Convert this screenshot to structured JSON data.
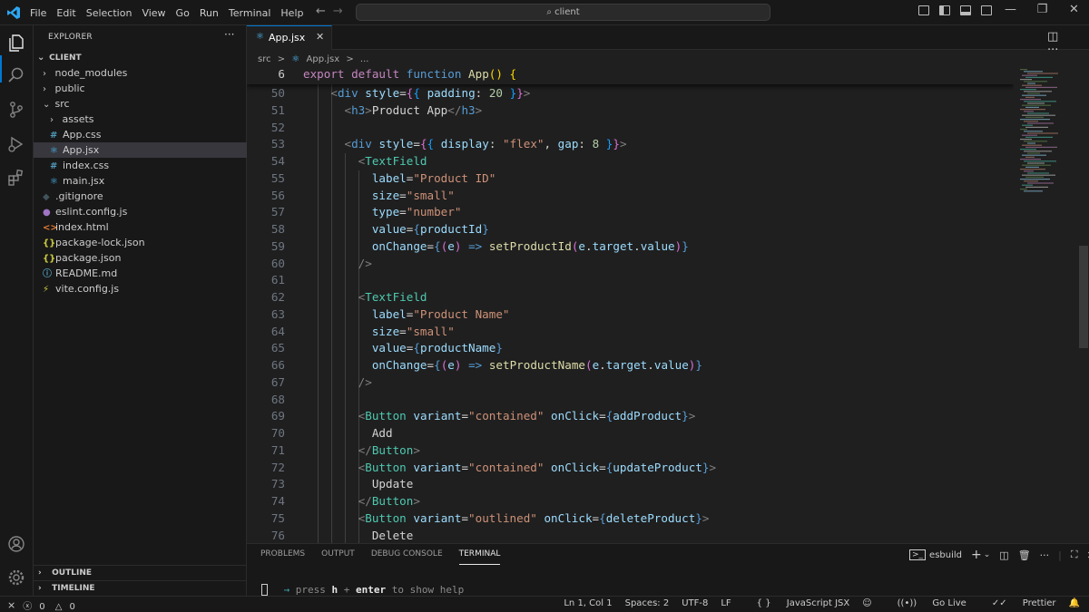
{
  "titlebar": {
    "menu": [
      "File",
      "Edit",
      "Selection",
      "View",
      "Go",
      "Run",
      "Terminal",
      "Help"
    ],
    "search": "client"
  },
  "sidebar": {
    "title": "EXPLORER",
    "more": "···",
    "root": "CLIENT",
    "items": [
      {
        "label": "node_modules",
        "type": "folder",
        "indent": 1,
        "icon": ""
      },
      {
        "label": "public",
        "type": "folder",
        "indent": 1,
        "icon": ""
      },
      {
        "label": "src",
        "type": "folder-open",
        "indent": 1,
        "icon": ""
      },
      {
        "label": "assets",
        "type": "folder",
        "indent": 2,
        "icon": ""
      },
      {
        "label": "App.css",
        "type": "file",
        "indent": 2,
        "icon": "#",
        "color": "#519aba"
      },
      {
        "label": "App.jsx",
        "type": "file",
        "indent": 2,
        "icon": "⚛",
        "color": "#4fc1ff",
        "selected": true
      },
      {
        "label": "index.css",
        "type": "file",
        "indent": 2,
        "icon": "#",
        "color": "#519aba"
      },
      {
        "label": "main.jsx",
        "type": "file",
        "indent": 2,
        "icon": "⚛",
        "color": "#4fc1ff"
      },
      {
        "label": ".gitignore",
        "type": "file",
        "indent": 1,
        "icon": "◆",
        "color": "#41535b"
      },
      {
        "label": "eslint.config.js",
        "type": "file",
        "indent": 1,
        "icon": "●",
        "color": "#a074c4"
      },
      {
        "label": "index.html",
        "type": "file",
        "indent": 1,
        "icon": "<>",
        "color": "#e37933"
      },
      {
        "label": "package-lock.json",
        "type": "file",
        "indent": 1,
        "icon": "{}",
        "color": "#cbcb41"
      },
      {
        "label": "package.json",
        "type": "file",
        "indent": 1,
        "icon": "{}",
        "color": "#cbcb41"
      },
      {
        "label": "README.md",
        "type": "file",
        "indent": 1,
        "icon": "ⓘ",
        "color": "#519aba"
      },
      {
        "label": "vite.config.js",
        "type": "file",
        "indent": 1,
        "icon": "⚡",
        "color": "#cbcb41"
      }
    ],
    "outline": "OUTLINE",
    "timeline": "TIMELINE"
  },
  "editor": {
    "tab_label": "App.jsx",
    "breadcrumb": [
      "src",
      ">",
      "App.jsx",
      ">",
      "..."
    ],
    "sticky": {
      "num": "6",
      "tokens": [
        [
          "kw",
          "export"
        ],
        [
          "txt",
          " "
        ],
        [
          "kw",
          "default"
        ],
        [
          "txt",
          " "
        ],
        [
          "kw2",
          "function"
        ],
        [
          "txt",
          " "
        ],
        [
          "fn",
          "App"
        ],
        [
          "brk",
          "()"
        ],
        [
          "txt",
          " "
        ],
        [
          "brk",
          "{"
        ]
      ]
    },
    "lines": [
      {
        "num": "50",
        "indent": 2,
        "tokens": [
          [
            "pun",
            "<"
          ],
          [
            "kw2",
            "div"
          ],
          [
            "txt",
            " "
          ],
          [
            "attr",
            "style"
          ],
          [
            "txt",
            "="
          ],
          [
            "brk2",
            "{"
          ],
          [
            "brk3",
            "{"
          ],
          [
            "txt",
            " "
          ],
          [
            "attr",
            "padding"
          ],
          [
            "txt",
            ": "
          ],
          [
            "num",
            "20"
          ],
          [
            "txt",
            " "
          ],
          [
            "brk3",
            "}"
          ],
          [
            "brk2",
            "}"
          ],
          [
            "pun",
            ">"
          ]
        ]
      },
      {
        "num": "51",
        "indent": 3,
        "tokens": [
          [
            "pun",
            "<"
          ],
          [
            "kw2",
            "h3"
          ],
          [
            "pun",
            ">"
          ],
          [
            "txt",
            "Product App"
          ],
          [
            "pun",
            "</"
          ],
          [
            "kw2",
            "h3"
          ],
          [
            "pun",
            ">"
          ]
        ]
      },
      {
        "num": "52",
        "indent": 0,
        "tokens": []
      },
      {
        "num": "53",
        "indent": 3,
        "tokens": [
          [
            "pun",
            "<"
          ],
          [
            "kw2",
            "div"
          ],
          [
            "txt",
            " "
          ],
          [
            "attr",
            "style"
          ],
          [
            "txt",
            "="
          ],
          [
            "brk2",
            "{"
          ],
          [
            "brk3",
            "{"
          ],
          [
            "txt",
            " "
          ],
          [
            "attr",
            "display"
          ],
          [
            "txt",
            ": "
          ],
          [
            "str",
            "\"flex\""
          ],
          [
            "txt",
            ", "
          ],
          [
            "attr",
            "gap"
          ],
          [
            "txt",
            ": "
          ],
          [
            "num",
            "8"
          ],
          [
            "txt",
            " "
          ],
          [
            "brk3",
            "}"
          ],
          [
            "brk2",
            "}"
          ],
          [
            "pun",
            ">"
          ]
        ]
      },
      {
        "num": "54",
        "indent": 4,
        "tokens": [
          [
            "pun",
            "<"
          ],
          [
            "tag",
            "TextField"
          ]
        ]
      },
      {
        "num": "55",
        "indent": 5,
        "tokens": [
          [
            "attr",
            "label"
          ],
          [
            "txt",
            "="
          ],
          [
            "str",
            "\"Product ID\""
          ]
        ]
      },
      {
        "num": "56",
        "indent": 5,
        "tokens": [
          [
            "attr",
            "size"
          ],
          [
            "txt",
            "="
          ],
          [
            "str",
            "\"small\""
          ]
        ]
      },
      {
        "num": "57",
        "indent": 5,
        "tokens": [
          [
            "attr",
            "type"
          ],
          [
            "txt",
            "="
          ],
          [
            "str",
            "\"number\""
          ]
        ]
      },
      {
        "num": "58",
        "indent": 5,
        "tokens": [
          [
            "attr",
            "value"
          ],
          [
            "txt",
            "="
          ],
          [
            "kw2",
            "{"
          ],
          [
            "attr",
            "productId"
          ],
          [
            "kw2",
            "}"
          ]
        ]
      },
      {
        "num": "59",
        "indent": 5,
        "tokens": [
          [
            "attr",
            "onChange"
          ],
          [
            "txt",
            "="
          ],
          [
            "kw2",
            "{"
          ],
          [
            "brk2",
            "("
          ],
          [
            "attr",
            "e"
          ],
          [
            "brk2",
            ")"
          ],
          [
            "txt",
            " "
          ],
          [
            "kw2",
            "=>"
          ],
          [
            "txt",
            " "
          ],
          [
            "fn",
            "setProductId"
          ],
          [
            "brk2",
            "("
          ],
          [
            "attr",
            "e"
          ],
          [
            "txt",
            "."
          ],
          [
            "attr",
            "target"
          ],
          [
            "txt",
            "."
          ],
          [
            "attr",
            "value"
          ],
          [
            "brk2",
            ")"
          ],
          [
            "kw2",
            "}"
          ]
        ]
      },
      {
        "num": "60",
        "indent": 4,
        "tokens": [
          [
            "pun",
            "/>"
          ]
        ]
      },
      {
        "num": "61",
        "indent": 0,
        "tokens": []
      },
      {
        "num": "62",
        "indent": 4,
        "tokens": [
          [
            "pun",
            "<"
          ],
          [
            "tag",
            "TextField"
          ]
        ]
      },
      {
        "num": "63",
        "indent": 5,
        "tokens": [
          [
            "attr",
            "label"
          ],
          [
            "txt",
            "="
          ],
          [
            "str",
            "\"Product Name\""
          ]
        ]
      },
      {
        "num": "64",
        "indent": 5,
        "tokens": [
          [
            "attr",
            "size"
          ],
          [
            "txt",
            "="
          ],
          [
            "str",
            "\"small\""
          ]
        ]
      },
      {
        "num": "65",
        "indent": 5,
        "tokens": [
          [
            "attr",
            "value"
          ],
          [
            "txt",
            "="
          ],
          [
            "kw2",
            "{"
          ],
          [
            "attr",
            "productName"
          ],
          [
            "kw2",
            "}"
          ]
        ]
      },
      {
        "num": "66",
        "indent": 5,
        "tokens": [
          [
            "attr",
            "onChange"
          ],
          [
            "txt",
            "="
          ],
          [
            "kw2",
            "{"
          ],
          [
            "brk2",
            "("
          ],
          [
            "attr",
            "e"
          ],
          [
            "brk2",
            ")"
          ],
          [
            "txt",
            " "
          ],
          [
            "kw2",
            "=>"
          ],
          [
            "txt",
            " "
          ],
          [
            "fn",
            "setProductName"
          ],
          [
            "brk2",
            "("
          ],
          [
            "attr",
            "e"
          ],
          [
            "txt",
            "."
          ],
          [
            "attr",
            "target"
          ],
          [
            "txt",
            "."
          ],
          [
            "attr",
            "value"
          ],
          [
            "brk2",
            ")"
          ],
          [
            "kw2",
            "}"
          ]
        ]
      },
      {
        "num": "67",
        "indent": 4,
        "tokens": [
          [
            "pun",
            "/>"
          ]
        ]
      },
      {
        "num": "68",
        "indent": 0,
        "tokens": []
      },
      {
        "num": "69",
        "indent": 4,
        "tokens": [
          [
            "pun",
            "<"
          ],
          [
            "tag",
            "Button"
          ],
          [
            "txt",
            " "
          ],
          [
            "attr",
            "variant"
          ],
          [
            "txt",
            "="
          ],
          [
            "str",
            "\"contained\""
          ],
          [
            "txt",
            " "
          ],
          [
            "attr",
            "onClick"
          ],
          [
            "txt",
            "="
          ],
          [
            "kw2",
            "{"
          ],
          [
            "attr",
            "addProduct"
          ],
          [
            "kw2",
            "}"
          ],
          [
            "pun",
            ">"
          ]
        ]
      },
      {
        "num": "70",
        "indent": 5,
        "tokens": [
          [
            "txt",
            "Add"
          ]
        ]
      },
      {
        "num": "71",
        "indent": 4,
        "tokens": [
          [
            "pun",
            "</"
          ],
          [
            "tag",
            "Button"
          ],
          [
            "pun",
            ">"
          ]
        ]
      },
      {
        "num": "72",
        "indent": 4,
        "tokens": [
          [
            "pun",
            "<"
          ],
          [
            "tag",
            "Button"
          ],
          [
            "txt",
            " "
          ],
          [
            "attr",
            "variant"
          ],
          [
            "txt",
            "="
          ],
          [
            "str",
            "\"contained\""
          ],
          [
            "txt",
            " "
          ],
          [
            "attr",
            "onClick"
          ],
          [
            "txt",
            "="
          ],
          [
            "kw2",
            "{"
          ],
          [
            "attr",
            "updateProduct"
          ],
          [
            "kw2",
            "}"
          ],
          [
            "pun",
            ">"
          ]
        ]
      },
      {
        "num": "73",
        "indent": 5,
        "tokens": [
          [
            "txt",
            "Update"
          ]
        ]
      },
      {
        "num": "74",
        "indent": 4,
        "tokens": [
          [
            "pun",
            "</"
          ],
          [
            "tag",
            "Button"
          ],
          [
            "pun",
            ">"
          ]
        ]
      },
      {
        "num": "75",
        "indent": 4,
        "tokens": [
          [
            "pun",
            "<"
          ],
          [
            "tag",
            "Button"
          ],
          [
            "txt",
            " "
          ],
          [
            "attr",
            "variant"
          ],
          [
            "txt",
            "="
          ],
          [
            "str",
            "\"outlined\""
          ],
          [
            "txt",
            " "
          ],
          [
            "attr",
            "onClick"
          ],
          [
            "txt",
            "="
          ],
          [
            "kw2",
            "{"
          ],
          [
            "attr",
            "deleteProduct"
          ],
          [
            "kw2",
            "}"
          ],
          [
            "pun",
            ">"
          ]
        ]
      },
      {
        "num": "76",
        "indent": 5,
        "tokens": [
          [
            "txt",
            "Delete"
          ]
        ]
      }
    ]
  },
  "panel": {
    "tabs": [
      "PROBLEMS",
      "OUTPUT",
      "DEBUG CONSOLE",
      "TERMINAL"
    ],
    "active_tab": "TERMINAL",
    "terminal_name": "esbuild",
    "terminal_line": {
      "arrow": "→",
      "a": " press ",
      "key1": "h",
      "b": " + ",
      "key2": "enter",
      "c": " to show help"
    }
  },
  "status": {
    "errors": "0",
    "warnings": "0",
    "position": "Ln 1, Col 1",
    "spaces": "Spaces: 2",
    "encoding": "UTF-8",
    "eol": "LF",
    "language": "JavaScript JSX",
    "golive": "Go Live",
    "prettier": "Prettier"
  },
  "colors": {
    "accent": "#0078d4",
    "background": "#1f1f1f",
    "sidebar_bg": "#181818",
    "selection": "#37373d"
  }
}
